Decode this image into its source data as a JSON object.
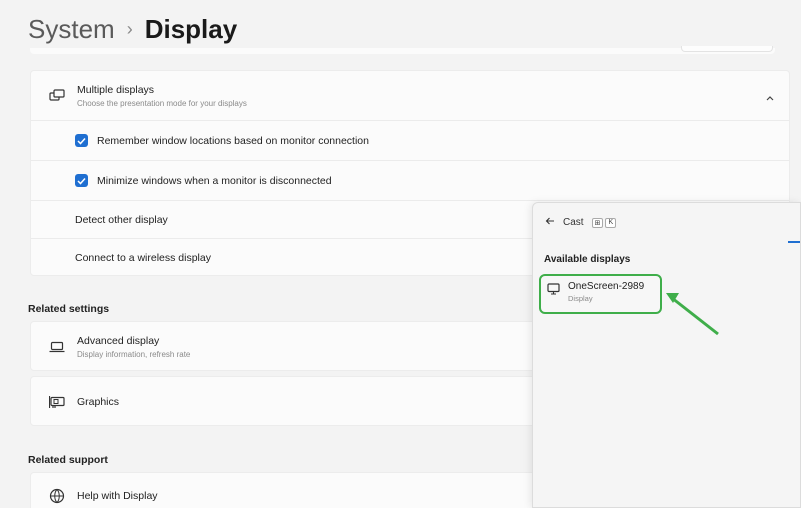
{
  "breadcrumb": {
    "parent": "System",
    "separator": "›",
    "current": "Display"
  },
  "multiple_displays": {
    "title": "Multiple displays",
    "subtitle": "Choose the presentation mode for your displays",
    "options": [
      {
        "label": "Remember window locations based on monitor connection",
        "checked": true
      },
      {
        "label": "Minimize windows when a monitor is disconnected",
        "checked": true
      }
    ],
    "detect_label": "Detect other display",
    "connect_label": "Connect to a wireless display"
  },
  "related_settings": {
    "heading": "Related settings",
    "advanced": {
      "title": "Advanced display",
      "subtitle": "Display information, refresh rate"
    },
    "graphics": {
      "title": "Graphics"
    }
  },
  "related_support": {
    "heading": "Related support",
    "help": {
      "title": "Help with Display"
    }
  },
  "cast_panel": {
    "title": "Cast",
    "shortcut_keys": [
      "⊞",
      "K"
    ],
    "section": "Available displays",
    "device": {
      "name": "OneScreen-2989",
      "type": "Display"
    }
  },
  "colors": {
    "accent": "#1f6fd1",
    "highlight": "#3fae4a"
  }
}
